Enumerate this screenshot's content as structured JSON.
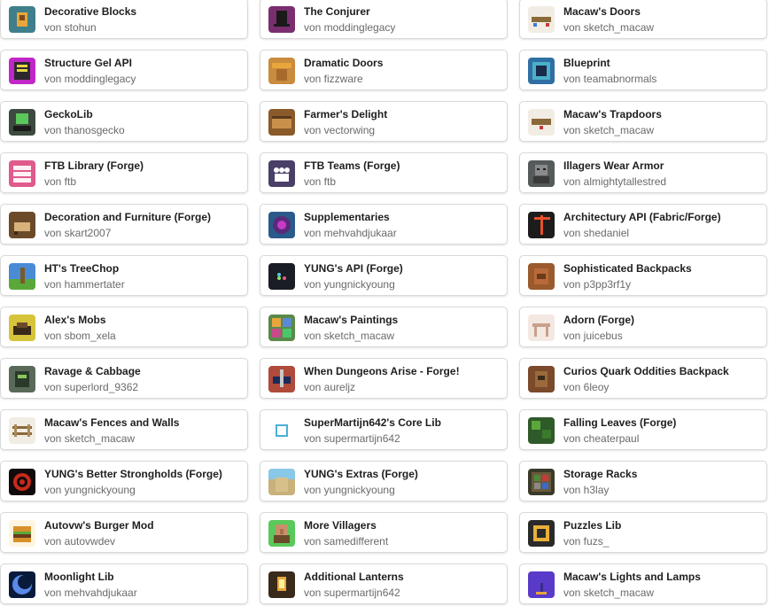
{
  "mods": [
    {
      "title": "Decorative Blocks",
      "author": "von stohun",
      "icon": "decorative-blocks-icon",
      "color": "#3f7f8c"
    },
    {
      "title": "The Conjurer",
      "author": "von moddinglegacy",
      "icon": "conjurer-hat-icon",
      "color": "#7a2e6f"
    },
    {
      "title": "Macaw's Doors",
      "author": "von sketch_macaw",
      "icon": "macaw-doors-icon",
      "color": "#f2ede4"
    },
    {
      "title": "Structure Gel API",
      "author": "von moddinglegacy",
      "icon": "structure-gel-icon",
      "color": "#c026c8"
    },
    {
      "title": "Dramatic Doors",
      "author": "von fizzware",
      "icon": "dramatic-doors-icon",
      "color": "#c98b3e"
    },
    {
      "title": "Blueprint",
      "author": "von teamabnormals",
      "icon": "blueprint-icon",
      "color": "#2f6fa3"
    },
    {
      "title": "GeckoLib",
      "author": "von thanosgecko",
      "icon": "geckolib-icon",
      "color": "#3d4a3f"
    },
    {
      "title": "Farmer's Delight",
      "author": "von vectorwing",
      "icon": "farmers-delight-icon",
      "color": "#8a5a2b"
    },
    {
      "title": "Macaw's Trapdoors",
      "author": "von sketch_macaw",
      "icon": "macaw-trapdoors-icon",
      "color": "#f2ede4"
    },
    {
      "title": "FTB Library (Forge)",
      "author": "von ftb",
      "icon": "ftb-library-icon",
      "color": "#e05a8c"
    },
    {
      "title": "FTB Teams (Forge)",
      "author": "von ftb",
      "icon": "ftb-teams-icon",
      "color": "#4a3f66"
    },
    {
      "title": "Illagers Wear Armor",
      "author": "von almightytallestred",
      "icon": "illager-icon",
      "color": "#555a5a"
    },
    {
      "title": "Decoration and Furniture (Forge)",
      "author": "von skart2007",
      "icon": "furniture-icon",
      "color": "#6b4a2a"
    },
    {
      "title": "Supplementaries",
      "author": "von mehvahdjukaar",
      "icon": "supplementaries-icon",
      "color": "#2a5a8a"
    },
    {
      "title": "Architectury API (Fabric/Forge)",
      "author": "von shedaniel",
      "icon": "architectury-crane-icon",
      "color": "#1c1c1c"
    },
    {
      "title": "HT's TreeChop",
      "author": "von hammertater",
      "icon": "treechop-icon",
      "color": "#4a8bd6"
    },
    {
      "title": "YUNG's API (Forge)",
      "author": "von yungnickyoung",
      "icon": "yungs-api-icon",
      "color": "#1a1d24"
    },
    {
      "title": "Sophisticated Backpacks",
      "author": "von p3pp3rf1y",
      "icon": "backpack-icon",
      "color": "#9a5a2c"
    },
    {
      "title": "Alex's Mobs",
      "author": "von sbom_xela",
      "icon": "alexs-mobs-icon",
      "color": "#d6c43a"
    },
    {
      "title": "Macaw's Paintings",
      "author": "von sketch_macaw",
      "icon": "paintings-icon",
      "color": "#5a8a4a"
    },
    {
      "title": "Adorn (Forge)",
      "author": "von juicebus",
      "icon": "adorn-table-icon",
      "color": "#f4e8e2"
    },
    {
      "title": "Ravage & Cabbage",
      "author": "von superlord_9362",
      "icon": "ravage-cabbage-icon",
      "color": "#5a6a5a"
    },
    {
      "title": "When Dungeons Arise - Forge!",
      "author": "von aureljz",
      "icon": "dungeons-arise-icon",
      "color": "#b04a3a"
    },
    {
      "title": "Curios Quark Oddities Backpack",
      "author": "von 6leoy",
      "icon": "oddities-backpack-icon",
      "color": "#7a4a2a"
    },
    {
      "title": "Macaw's Fences and Walls",
      "author": "von sketch_macaw",
      "icon": "fences-walls-icon",
      "color": "#f2ede4"
    },
    {
      "title": "SuperMartijn642's Core Lib",
      "author": "von supermartijn642",
      "icon": "core-lib-cube-icon",
      "color": "#ffffff"
    },
    {
      "title": "Falling Leaves (Forge)",
      "author": "von cheaterpaul",
      "icon": "falling-leaves-icon",
      "color": "#2f5a2a"
    },
    {
      "title": "YUNG's Better Strongholds (Forge)",
      "author": "von yungnickyoung",
      "icon": "better-strongholds-icon",
      "color": "#120a0a"
    },
    {
      "title": "YUNG's Extras (Forge)",
      "author": "von yungnickyoung",
      "icon": "yungs-extras-icon",
      "color": "#c8b27a"
    },
    {
      "title": "Storage Racks",
      "author": "von h3lay",
      "icon": "storage-racks-icon",
      "color": "#3a3a2a"
    },
    {
      "title": "Autovw's Burger Mod",
      "author": "von autovwdev",
      "icon": "burger-icon",
      "color": "#fff4e0"
    },
    {
      "title": "More Villagers",
      "author": "von samedifferent",
      "icon": "more-villagers-icon",
      "color": "#5ac85a"
    },
    {
      "title": "Puzzles Lib",
      "author": "von fuzs_",
      "icon": "puzzles-lib-icon",
      "color": "#2a2a2a"
    },
    {
      "title": "Moonlight Lib",
      "author": "von mehvahdjukaar",
      "icon": "moonlight-icon",
      "color": "#0a1a3a"
    },
    {
      "title": "Additional Lanterns",
      "author": "von supermartijn642",
      "icon": "lanterns-icon",
      "color": "#3a2a1a"
    },
    {
      "title": "Macaw's Lights and Lamps",
      "author": "von sketch_macaw",
      "icon": "lights-lamps-icon",
      "color": "#5a3ac8"
    }
  ]
}
